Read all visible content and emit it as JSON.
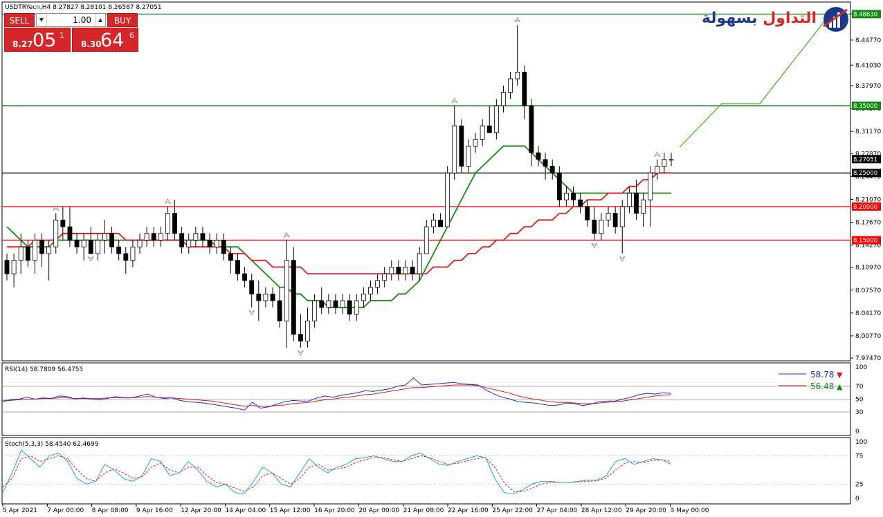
{
  "symbol_header": "USDTRYecn,H4  8.27827 8.28101 8.26587 8.27051",
  "trade_panel": {
    "sell_label": "SELL",
    "buy_label": "BUY",
    "lot": "1.00",
    "sell_price_small": "8.27",
    "sell_price_big": "05",
    "sell_price_sup": "1",
    "buy_price_small": "8.30",
    "buy_price_big": "64",
    "buy_price_sup": "6"
  },
  "logo": {
    "text_red": "التداول",
    "text_blue": "بسهولة"
  },
  "colors": {
    "up_candle_fill": "#ffffff",
    "down_candle_fill": "#000000",
    "ma_fast": "#e0191e",
    "ma_slow": "#138a13",
    "support_resistance_red": "#ff0000",
    "resistance_green": "#138a13",
    "key_level_black": "#000000",
    "rsi_line": "#1c2fd6",
    "rsi_signal": "#e0191e",
    "stoch_main": "#1ba6c4",
    "stoch_signal": "#e0191e",
    "projection_line": "#4aa61e"
  },
  "chart_data": [
    {
      "type": "candlestick",
      "price_ticks": [
        "8.48670",
        "8.44770",
        "8.41030",
        "8.37970",
        "8.34570",
        "8.31170",
        "8.27870",
        "8.24470",
        "8.21070",
        "8.17670",
        "8.14270",
        "8.10970",
        "8.07570",
        "8.04170",
        "8.00770",
        "7.97470"
      ],
      "ylim": [
        7.9747,
        8.4867
      ],
      "x_labels": [
        "5 Apr 2021",
        "7 Apr 00:00",
        "8 Apr 08:00",
        "9 Apr 16:00",
        "12 Apr 20:00",
        "14 Apr 04:00",
        "15 Apr 12:00",
        "16 Apr 20:00",
        "20 Apr 00:00",
        "21 Apr 08:00",
        "22 Apr 16:00",
        "25 Apr 22:00",
        "27 Apr 04:00",
        "28 Apr 12:00",
        "29 Apr 20:00",
        "3 May 00:00"
      ],
      "levels": [
        {
          "value": 8.4863,
          "label": "8.48630",
          "color": "#138a13"
        },
        {
          "value": 8.35,
          "label": "8.35000",
          "color": "#138a13"
        },
        {
          "value": 8.25,
          "label": "8.25000",
          "color": "#000000"
        },
        {
          "value": 8.2,
          "label": "8.20000",
          "color": "#ff0000"
        },
        {
          "value": 8.15,
          "label": "8.15000",
          "color": "#ff0000"
        }
      ],
      "current_price": "8.27051",
      "candles": [
        [
          8.12,
          8.13,
          8.09,
          8.1
        ],
        [
          8.1,
          8.13,
          8.08,
          8.12
        ],
        [
          8.12,
          8.16,
          8.1,
          8.14
        ],
        [
          8.14,
          8.15,
          8.11,
          8.12
        ],
        [
          8.12,
          8.16,
          8.1,
          8.15
        ],
        [
          8.15,
          8.16,
          8.11,
          8.13
        ],
        [
          8.13,
          8.15,
          8.09,
          8.14
        ],
        [
          8.14,
          8.19,
          8.13,
          8.18
        ],
        [
          8.18,
          8.2,
          8.15,
          8.17
        ],
        [
          8.17,
          8.2,
          8.14,
          8.15
        ],
        [
          8.15,
          8.16,
          8.13,
          8.14
        ],
        [
          8.14,
          8.16,
          8.12,
          8.15
        ],
        [
          8.15,
          8.17,
          8.13,
          8.13
        ],
        [
          8.13,
          8.16,
          8.12,
          8.15
        ],
        [
          8.15,
          8.18,
          8.13,
          8.16
        ],
        [
          8.16,
          8.17,
          8.13,
          8.14
        ],
        [
          8.14,
          8.15,
          8.12,
          8.13
        ],
        [
          8.13,
          8.14,
          8.1,
          8.12
        ],
        [
          8.12,
          8.15,
          8.11,
          8.14
        ],
        [
          8.14,
          8.16,
          8.13,
          8.15
        ],
        [
          8.15,
          8.17,
          8.14,
          8.16
        ],
        [
          8.16,
          8.17,
          8.14,
          8.15
        ],
        [
          8.15,
          8.17,
          8.14,
          8.16
        ],
        [
          8.16,
          8.2,
          8.15,
          8.19
        ],
        [
          8.19,
          8.21,
          8.15,
          8.16
        ],
        [
          8.16,
          8.17,
          8.13,
          8.14
        ],
        [
          8.14,
          8.16,
          8.13,
          8.15
        ],
        [
          8.15,
          8.17,
          8.14,
          8.16
        ],
        [
          8.16,
          8.17,
          8.14,
          8.15
        ],
        [
          8.15,
          8.16,
          8.13,
          8.14
        ],
        [
          8.14,
          8.16,
          8.13,
          8.15
        ],
        [
          8.15,
          8.16,
          8.12,
          8.13
        ],
        [
          8.13,
          8.14,
          8.1,
          8.12
        ],
        [
          8.12,
          8.13,
          8.09,
          8.1
        ],
        [
          8.1,
          8.11,
          8.08,
          8.09
        ],
        [
          8.09,
          8.1,
          8.05,
          8.07
        ],
        [
          8.07,
          8.09,
          8.03,
          8.06
        ],
        [
          8.06,
          8.08,
          8.05,
          8.07
        ],
        [
          8.07,
          8.08,
          8.05,
          8.06
        ],
        [
          8.06,
          8.08,
          8.02,
          8.03
        ],
        [
          8.03,
          8.15,
          7.99,
          8.12
        ],
        [
          8.12,
          8.14,
          8.0,
          8.01
        ],
        [
          8.01,
          8.04,
          7.99,
          8.0
        ],
        [
          8.0,
          8.05,
          7.99,
          8.03
        ],
        [
          8.03,
          8.07,
          8.02,
          8.06
        ],
        [
          8.06,
          8.08,
          8.04,
          8.05
        ],
        [
          8.05,
          8.07,
          8.04,
          8.06
        ],
        [
          8.06,
          8.07,
          8.04,
          8.05
        ],
        [
          8.05,
          8.07,
          8.04,
          8.06
        ],
        [
          8.06,
          8.07,
          8.03,
          8.04
        ],
        [
          8.04,
          8.07,
          8.03,
          8.06
        ],
        [
          8.06,
          8.08,
          8.05,
          8.07
        ],
        [
          8.07,
          8.09,
          8.06,
          8.08
        ],
        [
          8.08,
          8.1,
          8.07,
          8.09
        ],
        [
          8.09,
          8.11,
          8.08,
          8.1
        ],
        [
          8.1,
          8.12,
          8.09,
          8.11
        ],
        [
          8.11,
          8.12,
          8.09,
          8.1
        ],
        [
          8.1,
          8.12,
          8.09,
          8.11
        ],
        [
          8.11,
          8.12,
          8.09,
          8.1
        ],
        [
          8.1,
          8.14,
          8.09,
          8.13
        ],
        [
          8.13,
          8.18,
          8.13,
          8.17
        ],
        [
          8.17,
          8.19,
          8.16,
          8.18
        ],
        [
          8.18,
          8.19,
          8.17,
          8.17
        ],
        [
          8.17,
          8.26,
          8.17,
          8.25
        ],
        [
          8.25,
          8.35,
          8.24,
          8.32
        ],
        [
          8.32,
          8.33,
          8.25,
          8.26
        ],
        [
          8.26,
          8.3,
          8.25,
          8.29
        ],
        [
          8.29,
          8.31,
          8.28,
          8.3
        ],
        [
          8.3,
          8.33,
          8.29,
          8.32
        ],
        [
          8.32,
          8.35,
          8.31,
          8.31
        ],
        [
          8.31,
          8.36,
          8.3,
          8.35
        ],
        [
          8.35,
          8.38,
          8.34,
          8.37
        ],
        [
          8.37,
          8.4,
          8.36,
          8.39
        ],
        [
          8.39,
          8.47,
          8.38,
          8.4
        ],
        [
          8.4,
          8.41,
          8.33,
          8.35
        ],
        [
          8.35,
          8.36,
          8.26,
          8.28
        ],
        [
          8.28,
          8.29,
          8.26,
          8.27
        ],
        [
          8.27,
          8.28,
          8.24,
          8.26
        ],
        [
          8.26,
          8.27,
          8.24,
          8.25
        ],
        [
          8.25,
          8.26,
          8.2,
          8.21
        ],
        [
          8.21,
          8.23,
          8.2,
          8.22
        ],
        [
          8.22,
          8.23,
          8.2,
          8.21
        ],
        [
          8.21,
          8.22,
          8.19,
          8.2
        ],
        [
          8.2,
          8.21,
          8.17,
          8.18
        ],
        [
          8.18,
          8.2,
          8.15,
          8.16
        ],
        [
          8.16,
          8.19,
          8.15,
          8.18
        ],
        [
          8.18,
          8.2,
          8.17,
          8.19
        ],
        [
          8.19,
          8.2,
          8.16,
          8.17
        ],
        [
          8.17,
          8.21,
          8.13,
          8.2
        ],
        [
          8.2,
          8.23,
          8.19,
          8.22
        ],
        [
          8.22,
          8.24,
          8.18,
          8.19
        ],
        [
          8.19,
          8.22,
          8.17,
          8.21
        ],
        [
          8.21,
          8.26,
          8.17,
          8.25
        ],
        [
          8.25,
          8.27,
          8.24,
          8.26
        ],
        [
          8.26,
          8.28,
          8.25,
          8.27
        ],
        [
          8.27,
          8.28,
          8.26,
          8.27
        ]
      ],
      "ma_slow": [
        8.17,
        8.16,
        8.15,
        8.14,
        8.14,
        8.14,
        8.14,
        8.15,
        8.15,
        8.15,
        8.15,
        8.15,
        8.15,
        8.15,
        8.15,
        8.15,
        8.15,
        8.15,
        8.15,
        8.15,
        8.15,
        8.15,
        8.15,
        8.15,
        8.15,
        8.15,
        8.15,
        8.15,
        8.15,
        8.15,
        8.14,
        8.14,
        8.14,
        8.14,
        8.13,
        8.12,
        8.11,
        8.1,
        8.09,
        8.08,
        8.08,
        8.07,
        8.07,
        8.06,
        8.06,
        8.06,
        8.05,
        8.05,
        8.05,
        8.05,
        8.05,
        8.05,
        8.06,
        8.06,
        8.06,
        8.06,
        8.07,
        8.07,
        8.08,
        8.09,
        8.11,
        8.13,
        8.15,
        8.17,
        8.19,
        8.21,
        8.23,
        8.25,
        8.26,
        8.27,
        8.28,
        8.29,
        8.29,
        8.29,
        8.29,
        8.28,
        8.27,
        8.26,
        8.25,
        8.24,
        8.23,
        8.22,
        8.22,
        8.22,
        8.22,
        8.22,
        8.22,
        8.22,
        8.22,
        8.22,
        8.22,
        8.22,
        8.22,
        8.22,
        8.22,
        8.22
      ],
      "ma_fast": [
        8.14,
        8.14,
        8.14,
        8.14,
        8.15,
        8.15,
        8.15,
        8.15,
        8.16,
        8.16,
        8.16,
        8.16,
        8.16,
        8.16,
        8.16,
        8.16,
        8.16,
        8.15,
        8.15,
        8.15,
        8.15,
        8.15,
        8.15,
        8.15,
        8.15,
        8.15,
        8.14,
        8.14,
        8.14,
        8.14,
        8.14,
        8.14,
        8.13,
        8.13,
        8.13,
        8.12,
        8.12,
        8.12,
        8.11,
        8.11,
        8.11,
        8.11,
        8.11,
        8.1,
        8.1,
        8.1,
        8.1,
        8.1,
        8.1,
        8.1,
        8.1,
        8.1,
        8.1,
        8.1,
        8.1,
        8.1,
        8.1,
        8.1,
        8.1,
        8.1,
        8.1,
        8.11,
        8.11,
        8.11,
        8.12,
        8.12,
        8.13,
        8.13,
        8.14,
        8.14,
        8.15,
        8.15,
        8.16,
        8.16,
        8.17,
        8.17,
        8.18,
        8.18,
        8.18,
        8.19,
        8.19,
        8.2,
        8.2,
        8.21,
        8.21,
        8.21,
        8.22,
        8.22,
        8.22,
        8.23,
        8.23,
        8.24,
        8.24,
        8.25,
        8.25,
        8.25
      ]
    },
    {
      "type": "line",
      "title": "RSI(14) 58.7809 56.4755",
      "ylim": [
        0,
        100
      ],
      "ticks": [
        "100",
        "70",
        "50",
        "30",
        "0"
      ],
      "legend": [
        {
          "name": "58.78",
          "color": "#1c2fd6",
          "arrow": "▼",
          "arrow_color": "#e0191e"
        },
        {
          "name": "56.48",
          "color": "#e0191e",
          "arrow": "▲",
          "arrow_color": "#138a13"
        }
      ],
      "series": [
        {
          "color": "#1c2fd6",
          "values": [
            46,
            49,
            50,
            53,
            50,
            52,
            51,
            55,
            54,
            50,
            52,
            50,
            49,
            51,
            54,
            52,
            52,
            55,
            58,
            53,
            51,
            52,
            48,
            46,
            45,
            44,
            42,
            40,
            38,
            36,
            33,
            45,
            36,
            38,
            42,
            46,
            48,
            47,
            47,
            52,
            55,
            53,
            56,
            58,
            60,
            63,
            62,
            64,
            66,
            70,
            72,
            83,
            72,
            73,
            74,
            75,
            76,
            74,
            73,
            72,
            64,
            58,
            53,
            50,
            46,
            45,
            44,
            42,
            40,
            41,
            44,
            43,
            40,
            42,
            46,
            47,
            47,
            50,
            53,
            57,
            59,
            58,
            60,
            59
          ]
        },
        {
          "color": "#e0191e",
          "values": [
            48,
            48,
            49,
            50,
            50,
            51,
            51,
            52,
            52,
            51,
            51,
            51,
            51,
            52,
            52,
            52,
            52,
            53,
            54,
            53,
            52,
            52,
            51,
            50,
            49,
            48,
            47,
            45,
            43,
            41,
            39,
            40,
            39,
            39,
            40,
            41,
            43,
            44,
            45,
            47,
            49,
            50,
            52,
            53,
            55,
            57,
            58,
            60,
            62,
            64,
            66,
            68,
            68,
            69,
            70,
            71,
            72,
            72,
            72,
            71,
            68,
            65,
            62,
            59,
            55,
            52,
            50,
            48,
            46,
            45,
            45,
            44,
            43,
            43,
            44,
            45,
            46,
            47,
            49,
            51,
            53,
            55,
            56,
            57
          ]
        }
      ]
    },
    {
      "type": "line",
      "title": "Stoch(5,3,3) 58.4540 62.4699",
      "ylim": [
        0,
        100
      ],
      "ticks": [
        "100",
        "75",
        "25",
        "0"
      ],
      "series": [
        {
          "color": "#1ba6c4",
          "values": [
            10,
            45,
            85,
            70,
            55,
            75,
            80,
            65,
            35,
            25,
            30,
            60,
            50,
            35,
            30,
            40,
            70,
            65,
            40,
            45,
            65,
            50,
            30,
            20,
            25,
            10,
            8,
            30,
            55,
            45,
            25,
            20,
            45,
            70,
            55,
            45,
            55,
            60,
            70,
            72,
            75,
            70,
            65,
            65,
            75,
            80,
            70,
            60,
            58,
            65,
            70,
            75,
            72,
            35,
            10,
            8,
            15,
            25,
            30,
            30,
            28,
            28,
            30,
            32,
            32,
            40,
            65,
            70,
            60,
            65,
            70,
            68,
            60
          ]
        },
        {
          "color": "#e0191e",
          "values": [
            20,
            35,
            70,
            75,
            65,
            70,
            75,
            70,
            50,
            35,
            30,
            45,
            52,
            45,
            35,
            38,
            55,
            62,
            50,
            45,
            55,
            55,
            40,
            28,
            25,
            18,
            12,
            20,
            40,
            45,
            35,
            25,
            35,
            55,
            60,
            50,
            52,
            55,
            63,
            68,
            72,
            72,
            68,
            65,
            70,
            75,
            72,
            65,
            60,
            62,
            66,
            70,
            72,
            55,
            28,
            12,
            12,
            18,
            25,
            28,
            28,
            28,
            29,
            30,
            31,
            36,
            50,
            62,
            65,
            63,
            67,
            68,
            65
          ]
        }
      ]
    }
  ]
}
